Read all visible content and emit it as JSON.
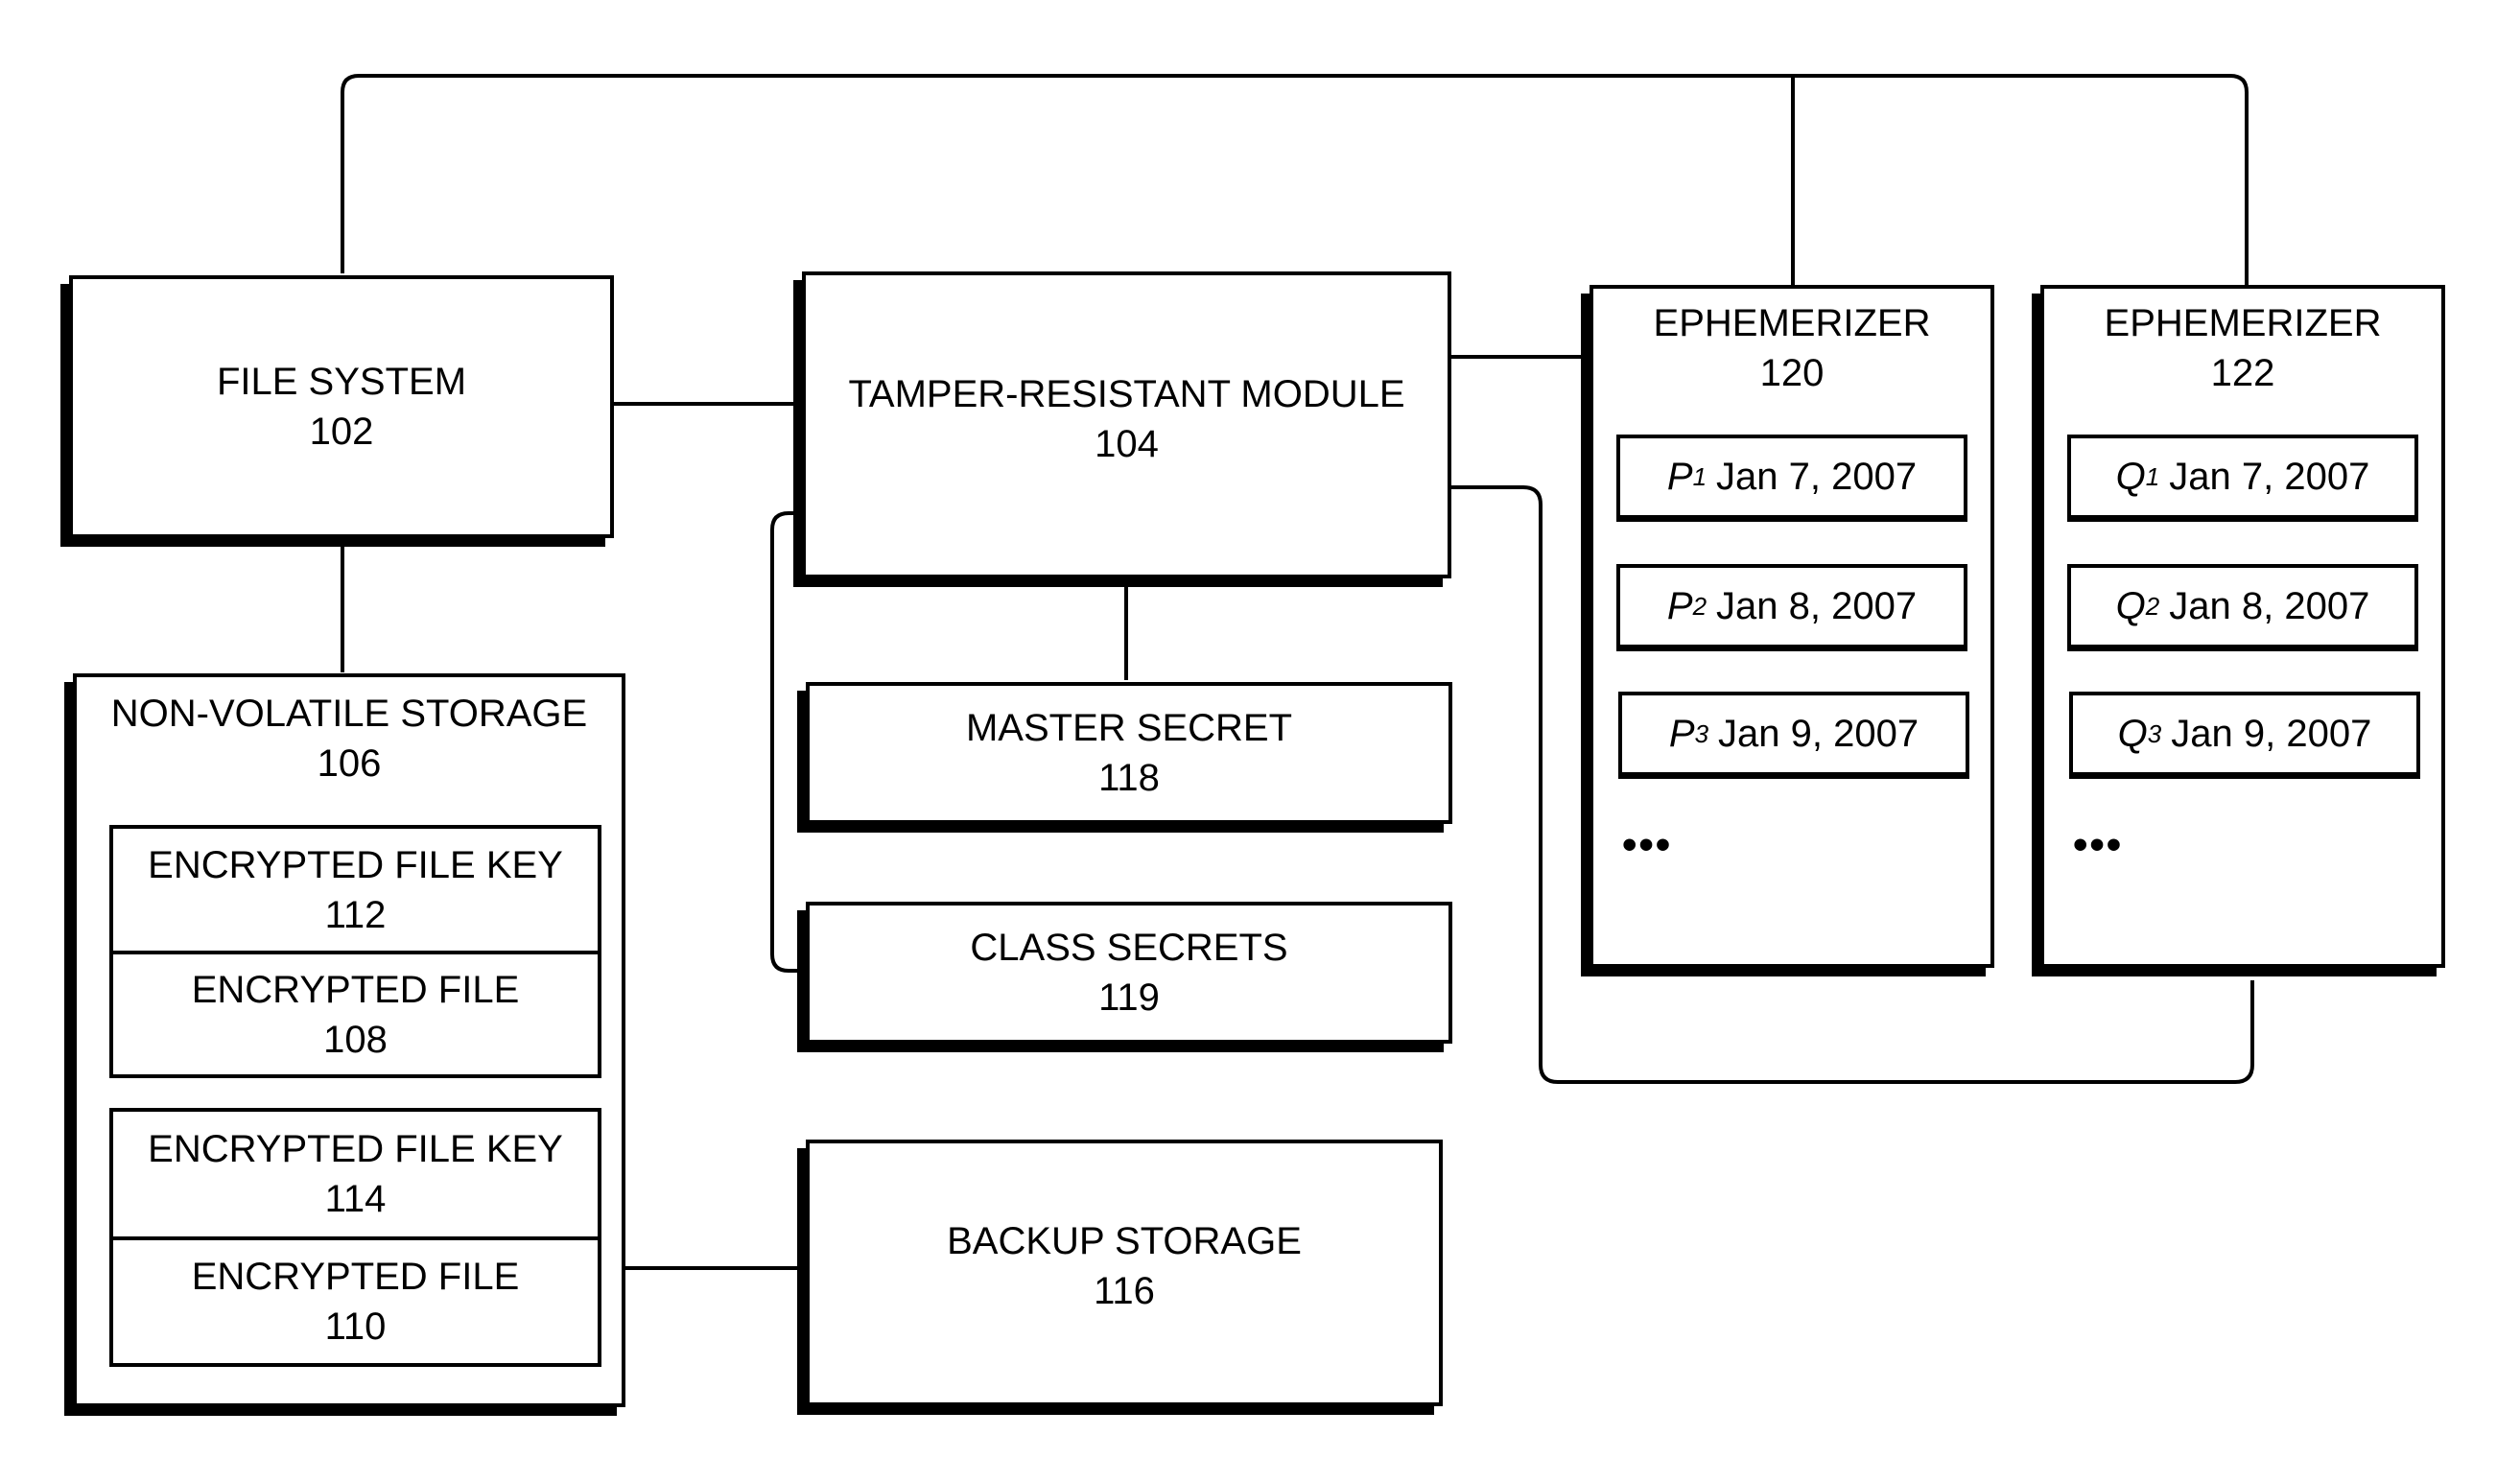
{
  "figure": {
    "file_system": {
      "title": "FILE SYSTEM",
      "ref": "102"
    },
    "tamper_resistant_module": {
      "title": "TAMPER-RESISTANT MODULE",
      "ref": "104"
    },
    "non_volatile_storage": {
      "title": "NON-VOLATILE STORAGE",
      "ref": "106",
      "groups": [
        {
          "key": {
            "title": "ENCRYPTED FILE KEY",
            "ref": "112"
          },
          "file": {
            "title": "ENCRYPTED FILE",
            "ref": "108"
          }
        },
        {
          "key": {
            "title": "ENCRYPTED FILE KEY",
            "ref": "114"
          },
          "file": {
            "title": "ENCRYPTED FILE",
            "ref": "110"
          }
        }
      ]
    },
    "master_secret": {
      "title": "MASTER SECRET",
      "ref": "118"
    },
    "class_secrets": {
      "title": "CLASS SECRETS",
      "ref": "119"
    },
    "backup_storage": {
      "title": "BACKUP STORAGE",
      "ref": "116"
    },
    "ephemerizers": [
      {
        "title": "EPHEMERIZER",
        "ref": "120",
        "entries": [
          {
            "key": "P",
            "sub": "1",
            "date": "Jan 7, 2007"
          },
          {
            "key": "P",
            "sub": "2",
            "date": "Jan 8, 2007"
          },
          {
            "key": "P",
            "sub": "3",
            "date": "Jan 9, 2007"
          }
        ],
        "more": "•••"
      },
      {
        "title": "EPHEMERIZER",
        "ref": "122",
        "entries": [
          {
            "key": "Q",
            "sub": "1",
            "date": "Jan 7, 2007"
          },
          {
            "key": "Q",
            "sub": "2",
            "date": "Jan 8, 2007"
          },
          {
            "key": "Q",
            "sub": "3",
            "date": "Jan 9, 2007"
          }
        ],
        "more": "•••"
      }
    ]
  }
}
